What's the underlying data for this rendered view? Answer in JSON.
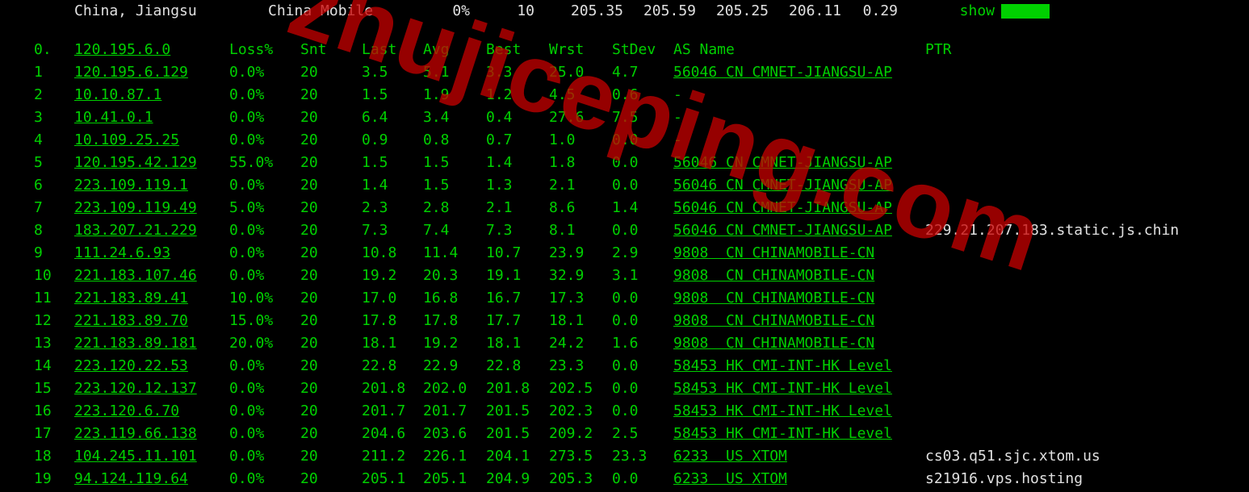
{
  "summary": {
    "location": "China, Jiangsu",
    "isp": "China Mobile",
    "loss": "0%",
    "snt": "10",
    "last": "205.35",
    "avg": "205.59",
    "best": "205.25",
    "wrst": "206.11",
    "stdev": "0.29",
    "show": "show"
  },
  "headers": {
    "idx": "0.",
    "host": "120.195.6.0",
    "loss": "Loss%",
    "snt": "Snt",
    "last": "Last",
    "avg": "Avg",
    "best": "Best",
    "wrst": "Wrst",
    "stdev": "StDev",
    "asname": "AS Name",
    "ptr": "PTR"
  },
  "hops": [
    {
      "idx": "1",
      "host": "120.195.6.129",
      "loss": "0.0%",
      "snt": "20",
      "last": "3.5",
      "avg": "5.1",
      "best": "3.3",
      "wrst": "25.0",
      "stdev": "4.7",
      "as": "56046 CN CMNET-JIANGSU-AP",
      "ptr": ""
    },
    {
      "idx": "2",
      "host": "10.10.87.1",
      "loss": "0.0%",
      "snt": "20",
      "last": "1.5",
      "avg": "1.9",
      "best": "1.2",
      "wrst": "4.5",
      "stdev": "0.6",
      "as": "-",
      "ptr": ""
    },
    {
      "idx": "3",
      "host": "10.41.0.1",
      "loss": "0.0%",
      "snt": "20",
      "last": "6.4",
      "avg": "3.4",
      "best": "0.4",
      "wrst": "27.6",
      "stdev": "7.5",
      "as": "-",
      "ptr": ""
    },
    {
      "idx": "4",
      "host": "10.109.25.25",
      "loss": "0.0%",
      "snt": "20",
      "last": "0.9",
      "avg": "0.8",
      "best": "0.7",
      "wrst": "1.0",
      "stdev": "0.0",
      "as": "-",
      "ptr": ""
    },
    {
      "idx": "5",
      "host": "120.195.42.129",
      "loss": "55.0%",
      "snt": "20",
      "last": "1.5",
      "avg": "1.5",
      "best": "1.4",
      "wrst": "1.8",
      "stdev": "0.0",
      "as": "56046 CN CMNET-JIANGSU-AP",
      "ptr": ""
    },
    {
      "idx": "6",
      "host": "223.109.119.1",
      "loss": "0.0%",
      "snt": "20",
      "last": "1.4",
      "avg": "1.5",
      "best": "1.3",
      "wrst": "2.1",
      "stdev": "0.0",
      "as": "56046 CN CMNET-JIANGSU-AP",
      "ptr": ""
    },
    {
      "idx": "7",
      "host": "223.109.119.49",
      "loss": "5.0%",
      "snt": "20",
      "last": "2.3",
      "avg": "2.8",
      "best": "2.1",
      "wrst": "8.6",
      "stdev": "1.4",
      "as": "56046 CN CMNET-JIANGSU-AP",
      "ptr": ""
    },
    {
      "idx": "8",
      "host": "183.207.21.229",
      "loss": "0.0%",
      "snt": "20",
      "last": "7.3",
      "avg": "7.4",
      "best": "7.3",
      "wrst": "8.1",
      "stdev": "0.0",
      "as": "56046 CN CMNET-JIANGSU-AP",
      "ptr": "229.21.207.183.static.js.chin"
    },
    {
      "idx": "9",
      "host": "111.24.6.93",
      "loss": "0.0%",
      "snt": "20",
      "last": "10.8",
      "avg": "11.4",
      "best": "10.7",
      "wrst": "23.9",
      "stdev": "2.9",
      "as": "9808  CN CHINAMOBILE-CN",
      "ptr": ""
    },
    {
      "idx": "10",
      "host": "221.183.107.46",
      "loss": "0.0%",
      "snt": "20",
      "last": "19.2",
      "avg": "20.3",
      "best": "19.1",
      "wrst": "32.9",
      "stdev": "3.1",
      "as": "9808  CN CHINAMOBILE-CN",
      "ptr": ""
    },
    {
      "idx": "11",
      "host": "221.183.89.41",
      "loss": "10.0%",
      "snt": "20",
      "last": "17.0",
      "avg": "16.8",
      "best": "16.7",
      "wrst": "17.3",
      "stdev": "0.0",
      "as": "9808  CN CHINAMOBILE-CN",
      "ptr": ""
    },
    {
      "idx": "12",
      "host": "221.183.89.70",
      "loss": "15.0%",
      "snt": "20",
      "last": "17.8",
      "avg": "17.8",
      "best": "17.7",
      "wrst": "18.1",
      "stdev": "0.0",
      "as": "9808  CN CHINAMOBILE-CN",
      "ptr": ""
    },
    {
      "idx": "13",
      "host": "221.183.89.181",
      "loss": "20.0%",
      "snt": "20",
      "last": "18.1",
      "avg": "19.2",
      "best": "18.1",
      "wrst": "24.2",
      "stdev": "1.6",
      "as": "9808  CN CHINAMOBILE-CN",
      "ptr": ""
    },
    {
      "idx": "14",
      "host": "223.120.22.53",
      "loss": "0.0%",
      "snt": "20",
      "last": "22.8",
      "avg": "22.9",
      "best": "22.8",
      "wrst": "23.3",
      "stdev": "0.0",
      "as": "58453 HK CMI-INT-HK Level",
      "ptr": ""
    },
    {
      "idx": "15",
      "host": "223.120.12.137",
      "loss": "0.0%",
      "snt": "20",
      "last": "201.8",
      "avg": "202.0",
      "best": "201.8",
      "wrst": "202.5",
      "stdev": "0.0",
      "as": "58453 HK CMI-INT-HK Level",
      "ptr": ""
    },
    {
      "idx": "16",
      "host": "223.120.6.70",
      "loss": "0.0%",
      "snt": "20",
      "last": "201.7",
      "avg": "201.7",
      "best": "201.5",
      "wrst": "202.3",
      "stdev": "0.0",
      "as": "58453 HK CMI-INT-HK Level",
      "ptr": ""
    },
    {
      "idx": "17",
      "host": "223.119.66.138",
      "loss": "0.0%",
      "snt": "20",
      "last": "204.6",
      "avg": "203.6",
      "best": "201.5",
      "wrst": "209.2",
      "stdev": "2.5",
      "as": "58453 HK CMI-INT-HK Level",
      "ptr": ""
    },
    {
      "idx": "18",
      "host": "104.245.11.101",
      "loss": "0.0%",
      "snt": "20",
      "last": "211.2",
      "avg": "226.1",
      "best": "204.1",
      "wrst": "273.5",
      "stdev": "23.3",
      "as": "6233  US XTOM",
      "ptr": "cs03.q51.sjc.xtom.us"
    },
    {
      "idx": "19",
      "host": "94.124.119.64",
      "loss": "0.0%",
      "snt": "20",
      "last": "205.1",
      "avg": "205.1",
      "best": "204.9",
      "wrst": "205.3",
      "stdev": "0.0",
      "as": "6233  US XTOM",
      "ptr": "s21916.vps.hosting"
    }
  ],
  "watermark": "zhujiceping.com"
}
